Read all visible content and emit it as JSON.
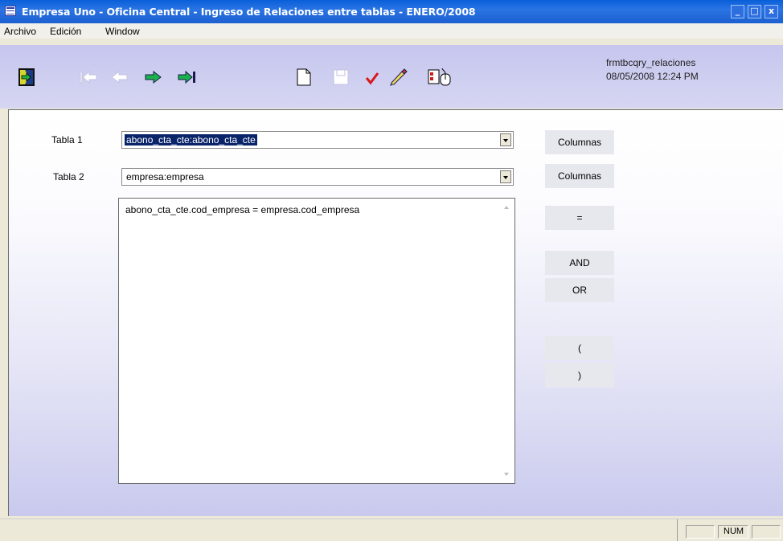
{
  "window": {
    "title": "Empresa Uno - Oficina Central - Ingreso de Relaciones entre tablas - ENERO/2008",
    "min_label": "_",
    "max_label": "□",
    "close_label": "x"
  },
  "menu": {
    "items": [
      "Archivo",
      "Edición",
      "Window"
    ]
  },
  "toolbar": {
    "form_name": "frmtbcqry_relaciones",
    "datetime": "08/05/2008 12:24 PM",
    "icons": [
      "exit-icon",
      "first-record-icon",
      "previous-record-icon",
      "next-record-icon",
      "last-record-icon",
      "new-document-icon",
      "save-icon",
      "check-icon",
      "edit-pencil-icon",
      "properties-icon"
    ]
  },
  "form": {
    "tabla1_label": "Tabla 1",
    "tabla1_value": "abono_cta_cte:abono_cta_cte",
    "tabla2_label": "Tabla 2",
    "tabla2_value": "empresa:empresa",
    "relation_text": "abono_cta_cte.cod_empresa = empresa.cod_empresa"
  },
  "buttons": {
    "columnas1": "Columnas",
    "columnas2": "Columnas",
    "equals": "=",
    "and": "AND",
    "or": "OR",
    "open_paren": "(",
    "close_paren": ")"
  },
  "statusbar": {
    "num": "NUM"
  },
  "colors": {
    "titlebar": "#1c5fd0",
    "toolbar_bg": "#c6c6ef",
    "selection": "#0a246a"
  }
}
